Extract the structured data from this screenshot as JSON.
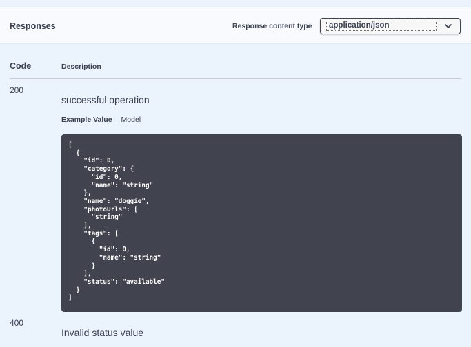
{
  "header": {
    "title": "Responses",
    "content_type_label": "Response content type",
    "content_type_value": "application/json"
  },
  "table": {
    "col_code": "Code",
    "col_description": "Description"
  },
  "responses": [
    {
      "code": "200",
      "description": "successful operation",
      "tab_example": "Example Value",
      "tab_model": "Model",
      "example": "[\n  {\n    \"id\": 0,\n    \"category\": {\n      \"id\": 0,\n      \"name\": \"string\"\n    },\n    \"name\": \"doggie\",\n    \"photoUrls\": [\n      \"string\"\n    ],\n    \"tags\": [\n      {\n        \"id\": 0,\n        \"name\": \"string\"\n      }\n    ],\n    \"status\": \"available\"\n  }\n]"
    },
    {
      "code": "400",
      "description": "Invalid status value"
    }
  ],
  "icons": {
    "select_chevron": "chevron-down-icon"
  },
  "colors": {
    "background": "#ebf3fd",
    "header_bg": "#f8fafd",
    "text": "#3b4151",
    "code_bg": "#41444e",
    "code_text": "#ffffff"
  }
}
